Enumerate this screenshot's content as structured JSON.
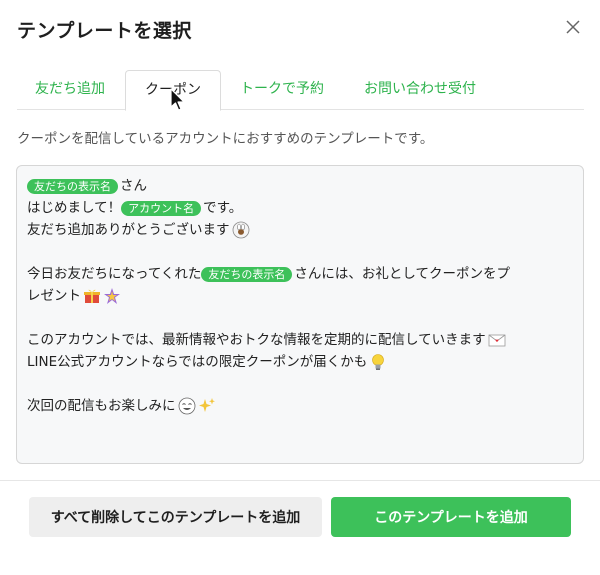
{
  "dialog": {
    "title": "テンプレートを選択",
    "close_icon": "close-icon"
  },
  "tabs": [
    {
      "label": "友だち追加",
      "active": false
    },
    {
      "label": "クーポン",
      "active": true
    },
    {
      "label": "トークで予約",
      "active": false
    },
    {
      "label": "お問い合わせ受付",
      "active": false
    }
  ],
  "description": "クーポンを配信しているアカウントにおすすめのテンプレートです。",
  "template": {
    "tag_friend_name": "友だちの表示名",
    "tag_account_name": "アカウント名",
    "l1_after": "さん",
    "l2_before": "はじめまして！",
    "l2_after": "です。",
    "l3": "友だち追加ありがとうございます",
    "l4_before": "今日お友だちになってくれた",
    "l4_after": "さんには、お礼としてクーポンをプ",
    "l5": "レゼント",
    "l6": "このアカウントでは、最新情報やおトクな情報を定期的に配信していきます",
    "l7": "LINE公式アカウントならではの限定クーポンが届くかも",
    "l8": "次回の配信もお楽しみに",
    "emojis": [
      "bunny-emoji",
      "gift-emoji",
      "sparkle-star-emoji",
      "envelope-emoji",
      "lightbulb-emoji",
      "smiling-face-emoji",
      "sparkles-emoji"
    ]
  },
  "buttons": {
    "secondary_label": "すべて削除してこのテンプレートを追加",
    "primary_label": "このテンプレートを追加"
  },
  "colors": {
    "accent": "#3dc15a",
    "tab_text": "#2eb34d"
  }
}
